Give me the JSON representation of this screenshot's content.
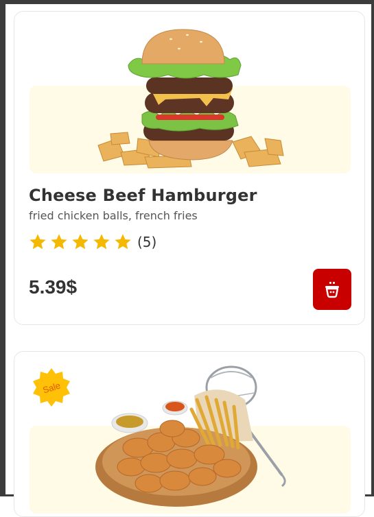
{
  "products": [
    {
      "name": "Cheese Beef Hamburger",
      "description": "fried chicken balls, french fries",
      "rating": 5,
      "rating_count": "(5)",
      "price": "5.39$",
      "image": "hamburger-image",
      "cart_icon": "basket-icon"
    },
    {
      "badge": "Sale",
      "image": "chicken-nuggets-image"
    }
  ],
  "colors": {
    "accent": "#c90000",
    "star": "#f5b800",
    "image_bg": "#fffbe6",
    "badge": "#ffc107"
  }
}
